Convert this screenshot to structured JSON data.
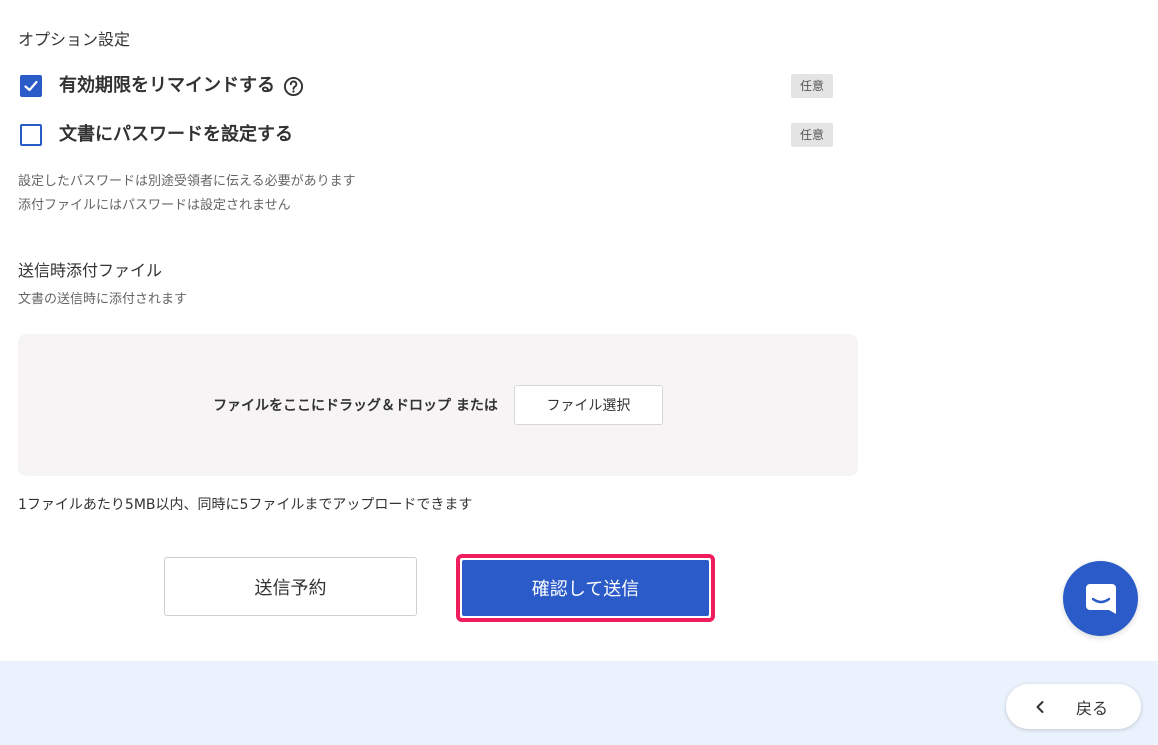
{
  "options": {
    "title": "オプション設定",
    "items": [
      {
        "label": "有効期限をリマインドする",
        "checked": true,
        "badge": "任意",
        "has_help": true
      },
      {
        "label": "文書にパスワードを設定する",
        "checked": false,
        "badge": "任意",
        "has_help": false
      }
    ],
    "notes": [
      "設定したパスワードは別途受領者に伝える必要があります",
      "添付ファイルにはパスワードは設定されません"
    ]
  },
  "attachments": {
    "title": "送信時添付ファイル",
    "subtitle": "文書の送信時に添付されます",
    "drop_text": "ファイルをここにドラッグ＆ドロップ または",
    "select_button": "ファイル選択",
    "limit_note": "1ファイルあたり5MB以内、同時に5ファイルまでアップロードできます"
  },
  "actions": {
    "schedule": "送信予約",
    "confirm": "確認して送信"
  },
  "footer": {
    "back": "戻る"
  },
  "colors": {
    "primary": "#2a5bc8",
    "highlight": "#ef1d5c",
    "footer_bg": "#eaf2fd"
  }
}
